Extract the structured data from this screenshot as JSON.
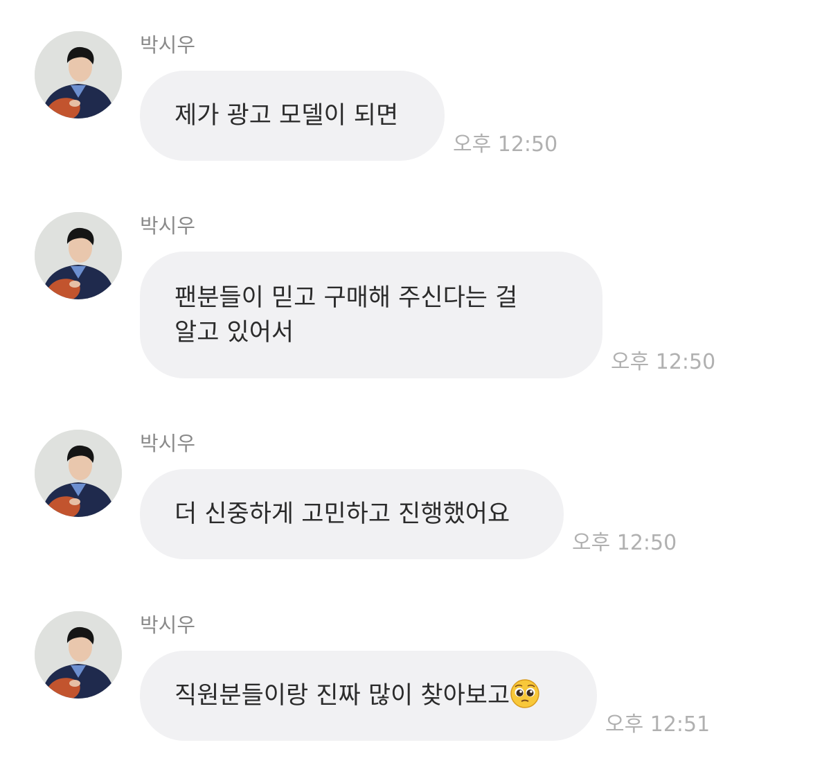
{
  "messages": [
    {
      "sender": "박시우",
      "lines": [
        "제가 광고 모델이 되면"
      ],
      "time": "오후 12:50"
    },
    {
      "sender": "박시우",
      "lines": [
        "팬분들이 믿고 구매해 주신다는 걸",
        "알고 있어서"
      ],
      "time": "오후 12:50"
    },
    {
      "sender": "박시우",
      "lines": [
        "더 신중하게 고민하고 진행했어요"
      ],
      "time": "오후 12:50"
    },
    {
      "sender": "박시우",
      "lines": [
        "직원분들이랑 진짜 많이 찾아보고"
      ],
      "emoji": "pleading-face-emoji",
      "time": "오후 12:51"
    }
  ],
  "colors": {
    "bubble": "#f1f1f3",
    "text": "#2b2b2b",
    "sender": "#8a8a8a",
    "timestamp": "#b0b0b0"
  }
}
